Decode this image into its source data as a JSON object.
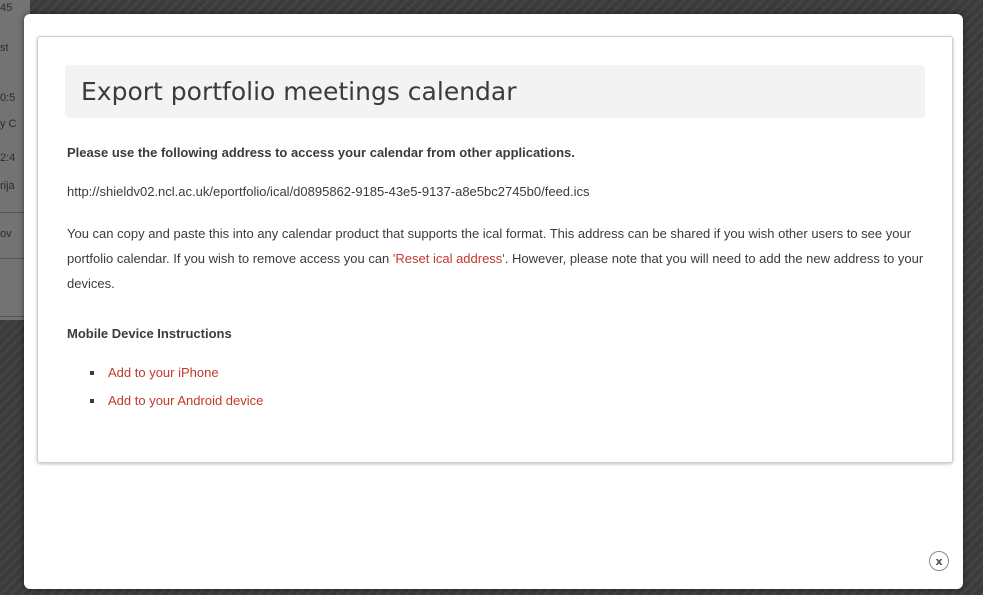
{
  "background": {
    "fragments": [
      "45",
      "st",
      "0:5",
      "y C",
      "2:4",
      "rija",
      "ov"
    ]
  },
  "modal": {
    "title": "Export portfolio meetings calendar",
    "intro": "Please use the following address to access your calendar from other applications.",
    "ical_url": "http://shieldv02.ncl.ac.uk/eportfolio/ical/d0895862-9185-43e5-9137-a8e5bc2745b0/feed.ics",
    "description_before_link": "You can copy and paste this into any calendar product that supports the ical format. This address can be shared if you wish other users to see your portfolio calendar. If you wish to remove access you can ",
    "reset_link": "'Reset ical address'",
    "description_after_link": ". However, please note that you will need to add the new address to your devices.",
    "mobile_heading": "Mobile Device Instructions",
    "mobile_links": [
      {
        "label": "Add to your iPhone"
      },
      {
        "label": "Add to your Android device"
      }
    ],
    "close_icon": "close-icon",
    "close_glyph": "x"
  },
  "colors": {
    "link": "#c0392b",
    "text": "#3b3b3b",
    "title_bar_bg": "#f3f3f3",
    "overlay": "#3b3b3b"
  }
}
